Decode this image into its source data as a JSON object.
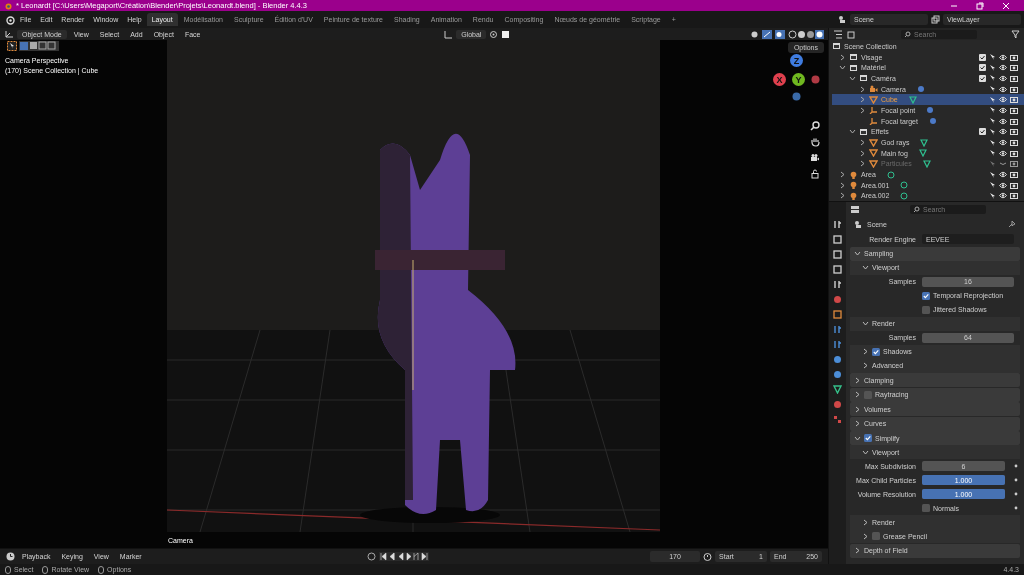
{
  "window": {
    "title": "* Leonardt [C:\\Users\\Megaport\\Création\\Blender\\Projets\\Leonardt.blend] - Blender 4.4.3"
  },
  "menu": [
    "File",
    "Edit",
    "Render",
    "Window",
    "Help"
  ],
  "workspaces": [
    {
      "label": "Layout",
      "selected": true
    },
    {
      "label": "Modélisation",
      "selected": false
    },
    {
      "label": "Sculpture",
      "selected": false
    },
    {
      "label": "Édition d'UV",
      "selected": false
    },
    {
      "label": "Peinture de texture",
      "selected": false
    },
    {
      "label": "Shading",
      "selected": false
    },
    {
      "label": "Animation",
      "selected": false
    },
    {
      "label": "Rendu",
      "selected": false
    },
    {
      "label": "Compositing",
      "selected": false
    },
    {
      "label": "Nœuds de géométrie",
      "selected": false
    },
    {
      "label": "Scriptage",
      "selected": false
    },
    {
      "label": "+",
      "selected": false
    }
  ],
  "scene": "Scene",
  "view_layer": "ViewLayer",
  "viewport": {
    "mode": "Object Mode",
    "menus": [
      "View",
      "Select",
      "Add",
      "Object",
      "Face"
    ],
    "transform": "Global",
    "options": "Options",
    "overlay_lines": [
      "Camera Perspective",
      "(170) Scene Collection | Cube"
    ],
    "camera_label": "Camera",
    "gizmo_axes": [
      "Z",
      "X",
      "Y"
    ]
  },
  "outliner": {
    "search_placeholder": "Search",
    "root": "Scene Collection",
    "items": [
      {
        "name": "Visage",
        "kind": "collection",
        "expanded": false,
        "checked": true,
        "selected": false,
        "disabled": false
      },
      {
        "name": "Matériel",
        "kind": "collection",
        "expanded": true,
        "checked": true,
        "selected": false,
        "disabled": false,
        "children": [
          {
            "name": "Caméra",
            "kind": "collection",
            "expanded": true,
            "checked": true,
            "selected": false,
            "disabled": false,
            "children": [
              {
                "name": "Camera",
                "kind": "camera",
                "expanded": false,
                "selected": false,
                "disabled": false
              },
              {
                "name": "Cube",
                "kind": "mesh",
                "expanded": false,
                "selected": true,
                "disabled": false
              },
              {
                "name": "Focal point",
                "kind": "empty",
                "expanded": false,
                "selected": false,
                "disabled": false
              },
              {
                "name": "Focal target",
                "kind": "empty",
                "selected": false,
                "disabled": false
              }
            ]
          },
          {
            "name": "Effets",
            "kind": "collection",
            "expanded": true,
            "checked": true,
            "selected": false,
            "disabled": false,
            "children": [
              {
                "name": "God rays",
                "kind": "mesh",
                "expanded": false,
                "selected": false,
                "disabled": false
              },
              {
                "name": "Main fog",
                "kind": "mesh",
                "expanded": false,
                "selected": false,
                "disabled": false
              },
              {
                "name": "Particules",
                "kind": "mesh",
                "expanded": false,
                "selected": false,
                "disabled": true
              }
            ]
          }
        ]
      },
      {
        "name": "Area",
        "kind": "light",
        "expanded": false,
        "selected": false,
        "disabled": false
      },
      {
        "name": "Area.001",
        "kind": "light",
        "expanded": false,
        "selected": false,
        "disabled": false
      },
      {
        "name": "Area.002",
        "kind": "light",
        "expanded": false,
        "selected": false,
        "disabled": false
      }
    ]
  },
  "properties": {
    "search_placeholder": "Search",
    "context": "Scene",
    "rows": [
      {
        "kind": "dropdown",
        "label": "Render Engine",
        "value": "EEVEE"
      },
      {
        "kind": "panel",
        "label": "Sampling",
        "expanded": true
      },
      {
        "kind": "subpanel",
        "label": "Viewport",
        "expanded": true
      },
      {
        "kind": "number",
        "label": "Samples",
        "value": "16"
      },
      {
        "kind": "check",
        "label": "Temporal Reprojection",
        "checked": true
      },
      {
        "kind": "check",
        "label": "Jittered Shadows",
        "checked": false
      },
      {
        "kind": "subpanel",
        "label": "Render",
        "expanded": true
      },
      {
        "kind": "number",
        "label": "Samples",
        "value": "64"
      },
      {
        "kind": "subpanel",
        "label": "Shadows",
        "expanded": false,
        "checked": true
      },
      {
        "kind": "subpanel",
        "label": "Advanced",
        "expanded": false
      },
      {
        "kind": "panel",
        "label": "Clamping",
        "expanded": false
      },
      {
        "kind": "panel",
        "label": "Raytracing",
        "expanded": false,
        "checked": false
      },
      {
        "kind": "panel",
        "label": "Volumes",
        "expanded": false
      },
      {
        "kind": "panel",
        "label": "Curves",
        "expanded": false
      },
      {
        "kind": "panel",
        "label": "Simplify",
        "expanded": true,
        "checked": true
      },
      {
        "kind": "subpanel",
        "label": "Viewport",
        "expanded": true
      },
      {
        "kind": "number",
        "label": "Max Subdivision",
        "value": "6",
        "keyframe_dot": true
      },
      {
        "kind": "slider",
        "label": "Max Child Particles",
        "value": "1.000",
        "level": 1,
        "keyframe_dot": true
      },
      {
        "kind": "slider",
        "label": "Volume Resolution",
        "value": "1.000",
        "level": 1,
        "keyframe_dot": true
      },
      {
        "kind": "check",
        "label": "Normals",
        "checked": false,
        "keyframe_dot": true
      },
      {
        "kind": "subpanel",
        "label": "Render",
        "expanded": false
      },
      {
        "kind": "subpanel",
        "label": "Grease Pencil",
        "expanded": false,
        "checked": false
      },
      {
        "kind": "panel",
        "label": "Depth of Field",
        "expanded": false
      }
    ]
  },
  "timeline": {
    "menus": [
      "Playback",
      "Keying",
      "View",
      "Marker"
    ],
    "frame": "170",
    "start_label": "Start",
    "start": "1",
    "end_label": "End",
    "end": "250"
  },
  "status_bar": {
    "hints": [
      "Select",
      "Rotate View",
      "Options"
    ],
    "version": "4.4.3"
  }
}
